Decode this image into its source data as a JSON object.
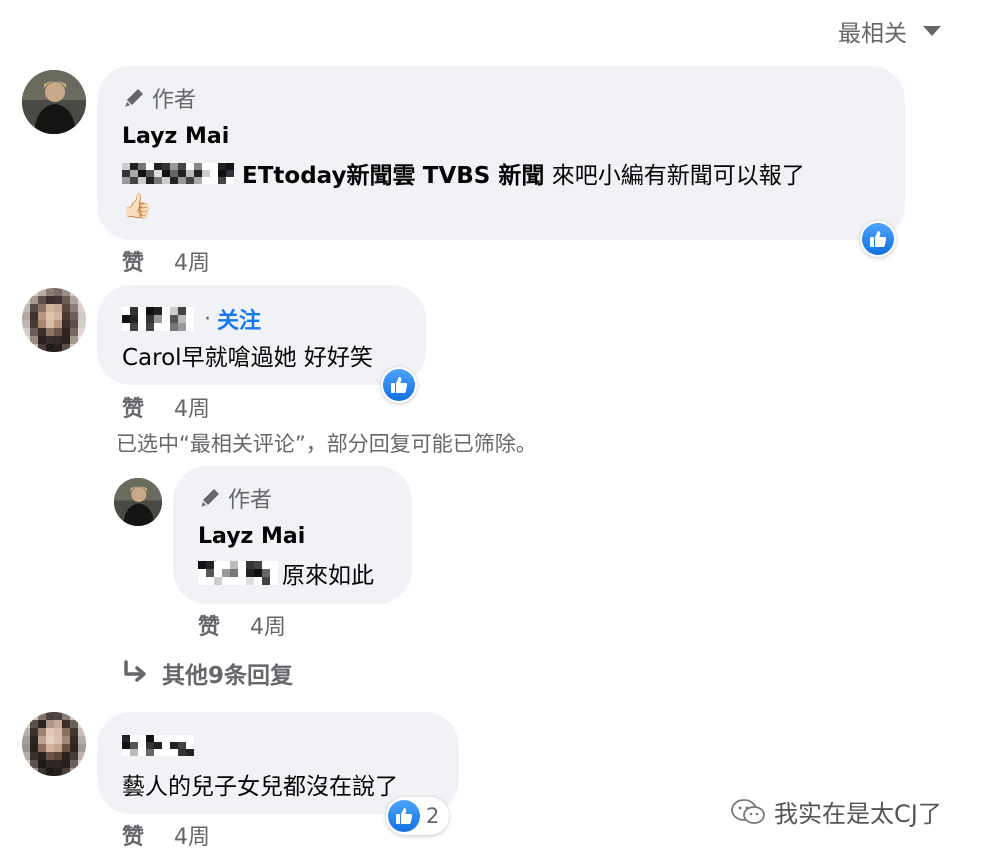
{
  "sort": {
    "label": "最相关"
  },
  "comments": [
    {
      "author_tag": "作者",
      "name": "Layz Mai",
      "mentions": [
        "ETtoday新聞雲",
        "TVBS 新聞"
      ],
      "text": "來吧小編有新聞可以報了",
      "emoji": "👍🏻",
      "like_label": "赞",
      "time": "4周"
    },
    {
      "follow_label": "关注",
      "text": "Carol早就嗆過她 好好笑",
      "like_label": "赞",
      "time": "4周"
    }
  ],
  "filter_notice": "已选中“最相关评论”，部分回复可能已筛除。",
  "reply": {
    "author_tag": "作者",
    "name": "Layz Mai",
    "text": "原來如此",
    "like_label": "赞",
    "time": "4周"
  },
  "more_replies": "其他9条回复",
  "comment3": {
    "text": "藝人的兒子女兒都沒在說了",
    "reaction_count": "2",
    "like_label": "赞",
    "time": "4周"
  },
  "watermark": "我实在是太CJ了",
  "colors": {
    "like_blue": "#1877f2",
    "bubble_bg": "#f0f2f5",
    "secondary_text": "#65676b"
  }
}
